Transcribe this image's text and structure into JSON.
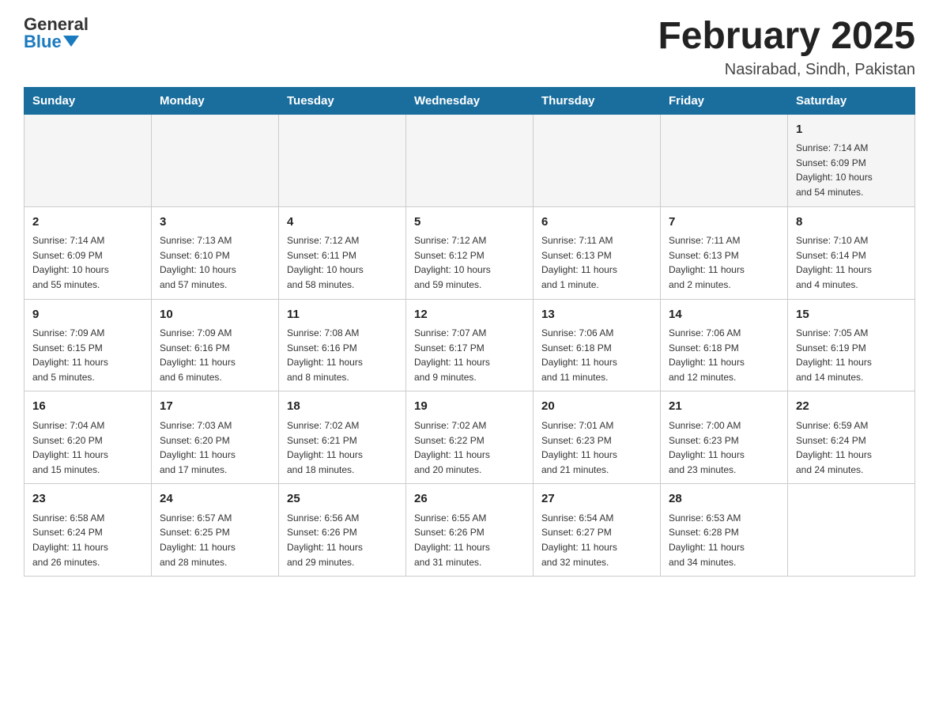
{
  "header": {
    "logo_general": "General",
    "logo_blue": "Blue",
    "title": "February 2025",
    "location": "Nasirabad, Sindh, Pakistan"
  },
  "weekdays": [
    "Sunday",
    "Monday",
    "Tuesday",
    "Wednesday",
    "Thursday",
    "Friday",
    "Saturday"
  ],
  "weeks": [
    [
      {
        "day": "",
        "info": ""
      },
      {
        "day": "",
        "info": ""
      },
      {
        "day": "",
        "info": ""
      },
      {
        "day": "",
        "info": ""
      },
      {
        "day": "",
        "info": ""
      },
      {
        "day": "",
        "info": ""
      },
      {
        "day": "1",
        "info": "Sunrise: 7:14 AM\nSunset: 6:09 PM\nDaylight: 10 hours\nand 54 minutes."
      }
    ],
    [
      {
        "day": "2",
        "info": "Sunrise: 7:14 AM\nSunset: 6:09 PM\nDaylight: 10 hours\nand 55 minutes."
      },
      {
        "day": "3",
        "info": "Sunrise: 7:13 AM\nSunset: 6:10 PM\nDaylight: 10 hours\nand 57 minutes."
      },
      {
        "day": "4",
        "info": "Sunrise: 7:12 AM\nSunset: 6:11 PM\nDaylight: 10 hours\nand 58 minutes."
      },
      {
        "day": "5",
        "info": "Sunrise: 7:12 AM\nSunset: 6:12 PM\nDaylight: 10 hours\nand 59 minutes."
      },
      {
        "day": "6",
        "info": "Sunrise: 7:11 AM\nSunset: 6:13 PM\nDaylight: 11 hours\nand 1 minute."
      },
      {
        "day": "7",
        "info": "Sunrise: 7:11 AM\nSunset: 6:13 PM\nDaylight: 11 hours\nand 2 minutes."
      },
      {
        "day": "8",
        "info": "Sunrise: 7:10 AM\nSunset: 6:14 PM\nDaylight: 11 hours\nand 4 minutes."
      }
    ],
    [
      {
        "day": "9",
        "info": "Sunrise: 7:09 AM\nSunset: 6:15 PM\nDaylight: 11 hours\nand 5 minutes."
      },
      {
        "day": "10",
        "info": "Sunrise: 7:09 AM\nSunset: 6:16 PM\nDaylight: 11 hours\nand 6 minutes."
      },
      {
        "day": "11",
        "info": "Sunrise: 7:08 AM\nSunset: 6:16 PM\nDaylight: 11 hours\nand 8 minutes."
      },
      {
        "day": "12",
        "info": "Sunrise: 7:07 AM\nSunset: 6:17 PM\nDaylight: 11 hours\nand 9 minutes."
      },
      {
        "day": "13",
        "info": "Sunrise: 7:06 AM\nSunset: 6:18 PM\nDaylight: 11 hours\nand 11 minutes."
      },
      {
        "day": "14",
        "info": "Sunrise: 7:06 AM\nSunset: 6:18 PM\nDaylight: 11 hours\nand 12 minutes."
      },
      {
        "day": "15",
        "info": "Sunrise: 7:05 AM\nSunset: 6:19 PM\nDaylight: 11 hours\nand 14 minutes."
      }
    ],
    [
      {
        "day": "16",
        "info": "Sunrise: 7:04 AM\nSunset: 6:20 PM\nDaylight: 11 hours\nand 15 minutes."
      },
      {
        "day": "17",
        "info": "Sunrise: 7:03 AM\nSunset: 6:20 PM\nDaylight: 11 hours\nand 17 minutes."
      },
      {
        "day": "18",
        "info": "Sunrise: 7:02 AM\nSunset: 6:21 PM\nDaylight: 11 hours\nand 18 minutes."
      },
      {
        "day": "19",
        "info": "Sunrise: 7:02 AM\nSunset: 6:22 PM\nDaylight: 11 hours\nand 20 minutes."
      },
      {
        "day": "20",
        "info": "Sunrise: 7:01 AM\nSunset: 6:23 PM\nDaylight: 11 hours\nand 21 minutes."
      },
      {
        "day": "21",
        "info": "Sunrise: 7:00 AM\nSunset: 6:23 PM\nDaylight: 11 hours\nand 23 minutes."
      },
      {
        "day": "22",
        "info": "Sunrise: 6:59 AM\nSunset: 6:24 PM\nDaylight: 11 hours\nand 24 minutes."
      }
    ],
    [
      {
        "day": "23",
        "info": "Sunrise: 6:58 AM\nSunset: 6:24 PM\nDaylight: 11 hours\nand 26 minutes."
      },
      {
        "day": "24",
        "info": "Sunrise: 6:57 AM\nSunset: 6:25 PM\nDaylight: 11 hours\nand 28 minutes."
      },
      {
        "day": "25",
        "info": "Sunrise: 6:56 AM\nSunset: 6:26 PM\nDaylight: 11 hours\nand 29 minutes."
      },
      {
        "day": "26",
        "info": "Sunrise: 6:55 AM\nSunset: 6:26 PM\nDaylight: 11 hours\nand 31 minutes."
      },
      {
        "day": "27",
        "info": "Sunrise: 6:54 AM\nSunset: 6:27 PM\nDaylight: 11 hours\nand 32 minutes."
      },
      {
        "day": "28",
        "info": "Sunrise: 6:53 AM\nSunset: 6:28 PM\nDaylight: 11 hours\nand 34 minutes."
      },
      {
        "day": "",
        "info": ""
      }
    ]
  ]
}
